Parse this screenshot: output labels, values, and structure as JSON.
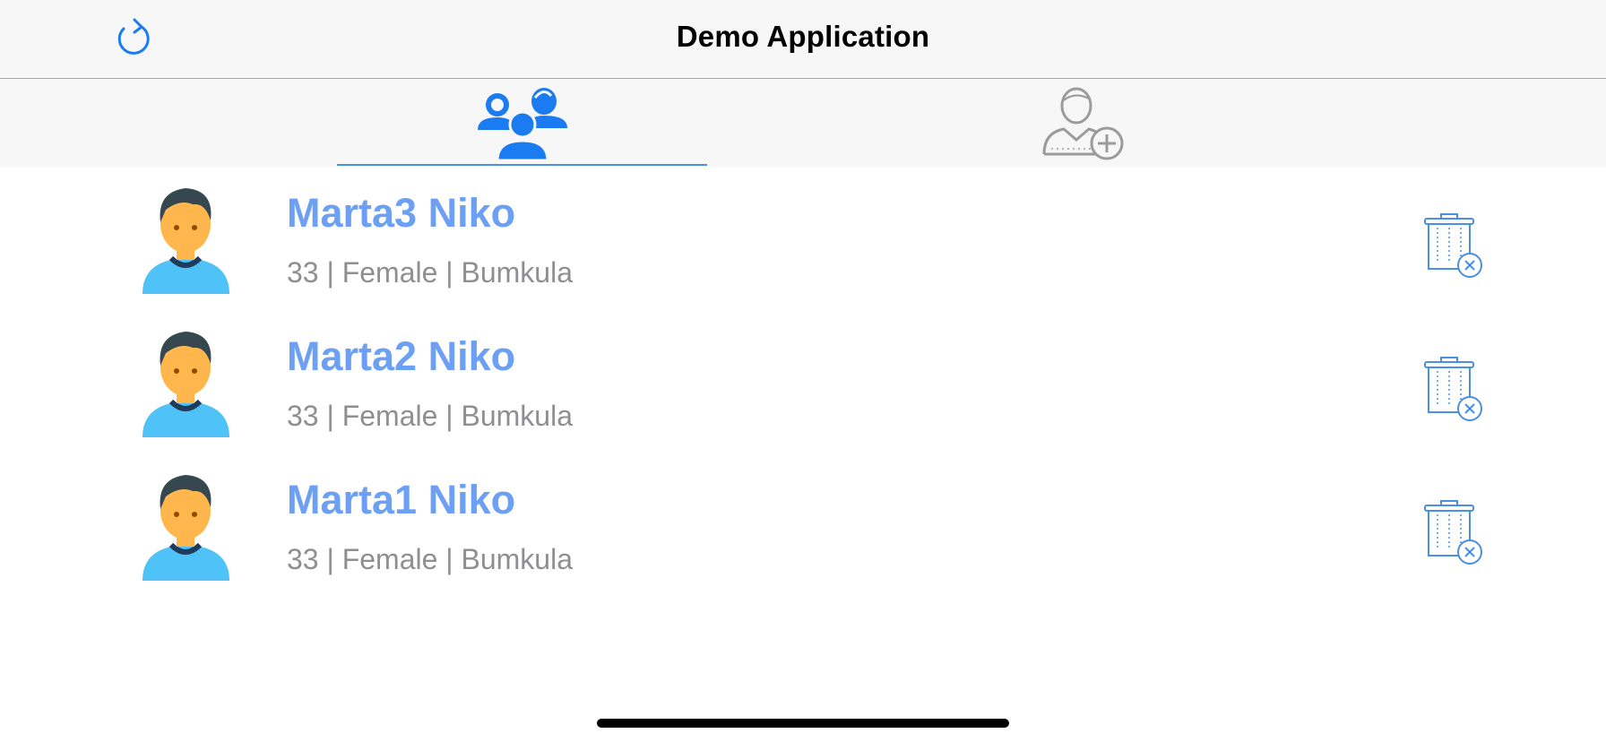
{
  "navbar": {
    "title": "Demo Application",
    "refresh_icon": "refresh-icon"
  },
  "tabs": [
    {
      "icon": "users-group-icon",
      "selected": true
    },
    {
      "icon": "add-user-icon",
      "selected": false
    }
  ],
  "colors": {
    "accent": "#4a90e2",
    "name_text": "#6ba0f5",
    "detail_text": "#8e8e93",
    "bar_background": "#f7f7f7",
    "avatar_skin": "#ffb74d",
    "avatar_shirt": "#4fc3f7",
    "avatar_hair": "#37474f"
  },
  "people": [
    {
      "name": "Marta3 Niko",
      "detail": "33 | Female | Bumkula",
      "avatar_icon": "person-avatar-icon",
      "delete_icon": "trash-delete-icon"
    },
    {
      "name": "Marta2 Niko",
      "detail": "33 | Female | Bumkula",
      "avatar_icon": "person-avatar-icon",
      "delete_icon": "trash-delete-icon"
    },
    {
      "name": "Marta1 Niko",
      "detail": "33 | Female | Bumkula",
      "avatar_icon": "person-avatar-icon",
      "delete_icon": "trash-delete-icon"
    }
  ]
}
